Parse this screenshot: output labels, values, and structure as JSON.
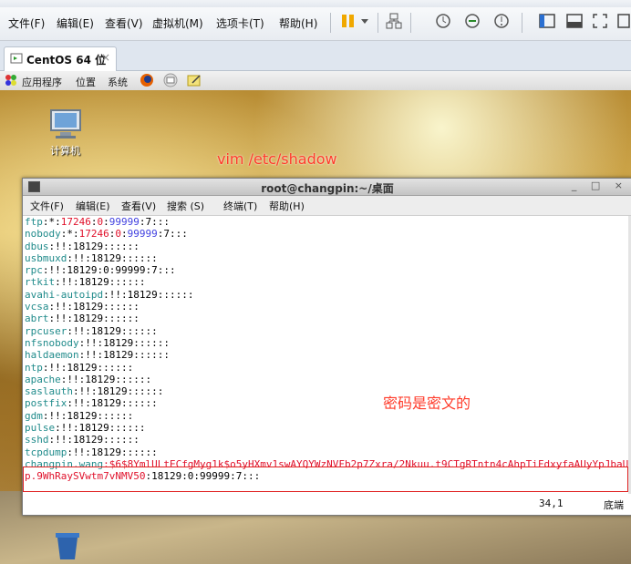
{
  "vmware": {
    "menus": [
      "文件(F)",
      "编辑(E)",
      "查看(V)",
      "虚拟机(M)",
      "选项卡(T)",
      "帮助(H)"
    ],
    "tab_label": "CentOS 64 位",
    "tab_close": "×"
  },
  "guest_panel": {
    "items": [
      "应用程序",
      "位置",
      "系统"
    ]
  },
  "desktop": {
    "computer_label": "计算机",
    "annotation_vim": "vim /etc/shadow",
    "annotation_cipher": "密码是密文的"
  },
  "terminal": {
    "title": "root@changpin:~/桌面",
    "controls": "_ □ ×",
    "menus": [
      "文件(F)",
      "编辑(E)",
      "查看(V)",
      "搜索 (S)",
      "终端(T)",
      "帮助(H)"
    ],
    "lines": [
      {
        "user": "ftp",
        "rest": ":*:17246:0:99999:7:::"
      },
      {
        "user": "nobody",
        "rest": ":*:17246:0:99999:7:::"
      },
      {
        "user": "dbus",
        "rest": ":!!:18129::::::"
      },
      {
        "user": "usbmuxd",
        "rest": ":!!:18129::::::"
      },
      {
        "user": "rpc",
        "rest": ":!!:18129:0:99999:7:::"
      },
      {
        "user": "rtkit",
        "rest": ":!!:18129::::::"
      },
      {
        "user": "avahi-autoipd",
        "rest": ":!!:18129::::::"
      },
      {
        "user": "vcsa",
        "rest": ":!!:18129::::::"
      },
      {
        "user": "abrt",
        "rest": ":!!:18129::::::"
      },
      {
        "user": "rpcuser",
        "rest": ":!!:18129::::::"
      },
      {
        "user": "nfsnobody",
        "rest": ":!!:18129::::::"
      },
      {
        "user": "haldaemon",
        "rest": ":!!:18129::::::"
      },
      {
        "user": "ntp",
        "rest": ":!!:18129::::::"
      },
      {
        "user": "apache",
        "rest": ":!!:18129::::::"
      },
      {
        "user": "saslauth",
        "rest": ":!!:18129::::::"
      },
      {
        "user": "postfix",
        "rest": ":!!:18129::::::"
      },
      {
        "user": "gdm",
        "rest": ":!!:18129::::::"
      },
      {
        "user": "pulse",
        "rest": ":!!:18129::::::"
      },
      {
        "user": "sshd",
        "rest": ":!!:18129::::::"
      },
      {
        "user": "tcpdump",
        "rest": ":!!:18129::::::"
      }
    ],
    "highlight_user": "changpin.wang",
    "highlight_hash_1": "$6$8YmlULtECfgMyg1k$o5yHXmv1swAYQYWzNVFb2p7Zxra/2Nkuu.t9CTgRTntn4cAhpTiFdxyfaAUyYpJbaU",
    "highlight_hash_2": "p.9WhRaySVwtm7vNMV50",
    "highlight_tail": ":18129:0:99999:7:::",
    "status_position": "34,1",
    "status_where": "底端"
  },
  "colors": {
    "user_cyan": "#208b8b",
    "number_red": "#e0112b",
    "annotation_red": "#ff3b2a"
  }
}
